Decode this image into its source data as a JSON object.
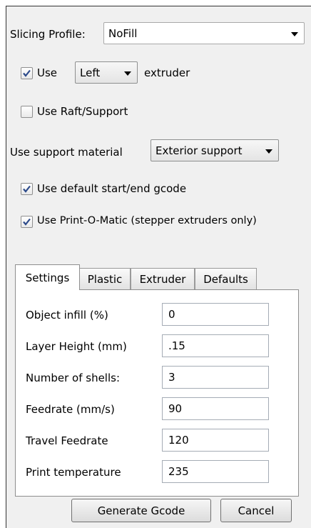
{
  "slicing_profile": {
    "label": "Slicing Profile:",
    "value": "NoFill"
  },
  "extruder_row": {
    "checkbox_label": "Use",
    "checked": true,
    "extruder_value": "Left",
    "suffix": "extruder"
  },
  "raft_support": {
    "label": "Use Raft/Support",
    "checked": false
  },
  "support_material": {
    "label": "Use support material",
    "value": "Exterior support"
  },
  "default_gcode": {
    "label": "Use default start/end gcode",
    "checked": true
  },
  "print_o_matic": {
    "label": "Use Print-O-Matic (stepper extruders only)",
    "checked": true
  },
  "tabs": [
    "Settings",
    "Plastic",
    "Extruder",
    "Defaults"
  ],
  "active_tab": "Settings",
  "settings": [
    {
      "label": "Object infill (%)",
      "value": "0"
    },
    {
      "label": "Layer Height (mm)",
      "value": ".15"
    },
    {
      "label": "Number of shells:",
      "value": "3"
    },
    {
      "label": "Feedrate (mm/s)",
      "value": "90"
    },
    {
      "label": "Travel Feedrate",
      "value": "120"
    },
    {
      "label": "Print temperature",
      "value": "235"
    }
  ],
  "buttons": {
    "generate": "Generate Gcode",
    "cancel": "Cancel"
  },
  "colors": {
    "checkmark": "#2c4a8a",
    "window_bg": "#f0f0f0"
  }
}
